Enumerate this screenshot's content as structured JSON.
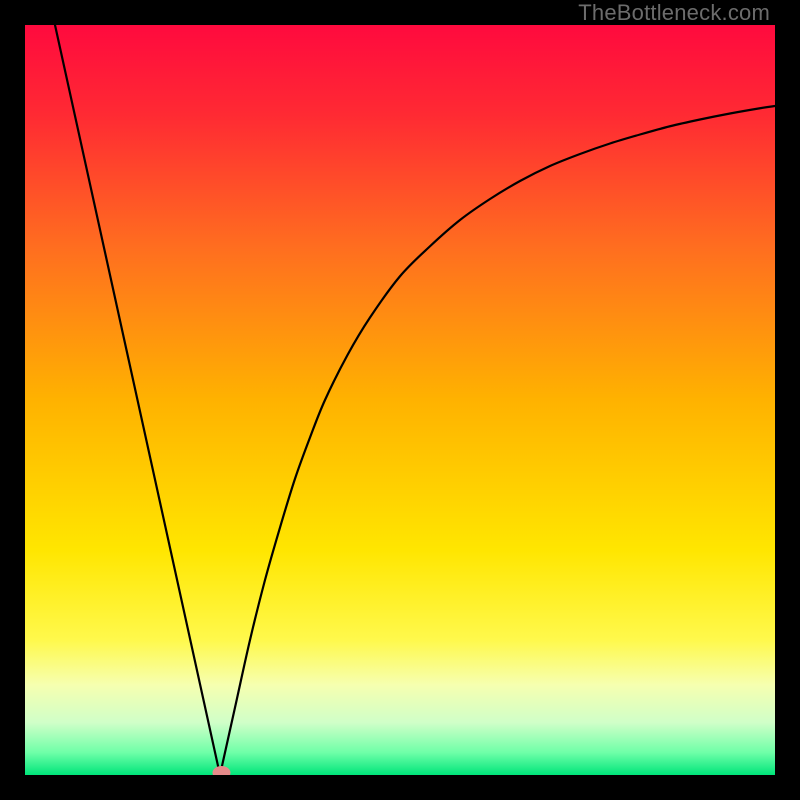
{
  "watermark": "TheBottleneck.com",
  "chart_data": {
    "type": "line",
    "title": "",
    "xlabel": "",
    "ylabel": "",
    "xlim": [
      0,
      1
    ],
    "ylim": [
      0,
      1
    ],
    "gradient_stops": [
      {
        "offset": 0.0,
        "color": "#ff0a3e"
      },
      {
        "offset": 0.12,
        "color": "#ff2a33"
      },
      {
        "offset": 0.3,
        "color": "#ff6f1f"
      },
      {
        "offset": 0.5,
        "color": "#ffb200"
      },
      {
        "offset": 0.7,
        "color": "#ffe600"
      },
      {
        "offset": 0.82,
        "color": "#fff94c"
      },
      {
        "offset": 0.88,
        "color": "#f6ffb0"
      },
      {
        "offset": 0.93,
        "color": "#d0ffc8"
      },
      {
        "offset": 0.97,
        "color": "#6fffa8"
      },
      {
        "offset": 1.0,
        "color": "#00e57a"
      }
    ],
    "series": [
      {
        "name": "left-line",
        "x": [
          0.04,
          0.26
        ],
        "values": [
          1.0,
          0.0
        ]
      },
      {
        "name": "right-curve",
        "x": [
          0.26,
          0.28,
          0.3,
          0.32,
          0.34,
          0.36,
          0.38,
          0.4,
          0.43,
          0.46,
          0.5,
          0.54,
          0.58,
          0.62,
          0.66,
          0.7,
          0.74,
          0.78,
          0.82,
          0.86,
          0.9,
          0.94,
          0.98,
          1.0
        ],
        "values": [
          0.0,
          0.09,
          0.18,
          0.26,
          0.33,
          0.395,
          0.45,
          0.5,
          0.56,
          0.61,
          0.665,
          0.705,
          0.74,
          0.768,
          0.792,
          0.812,
          0.828,
          0.842,
          0.854,
          0.865,
          0.874,
          0.882,
          0.889,
          0.892
        ]
      }
    ],
    "marker": {
      "x": 0.262,
      "y": 0.003,
      "rx": 0.012,
      "ry": 0.009,
      "color": "#e58a8a"
    }
  }
}
